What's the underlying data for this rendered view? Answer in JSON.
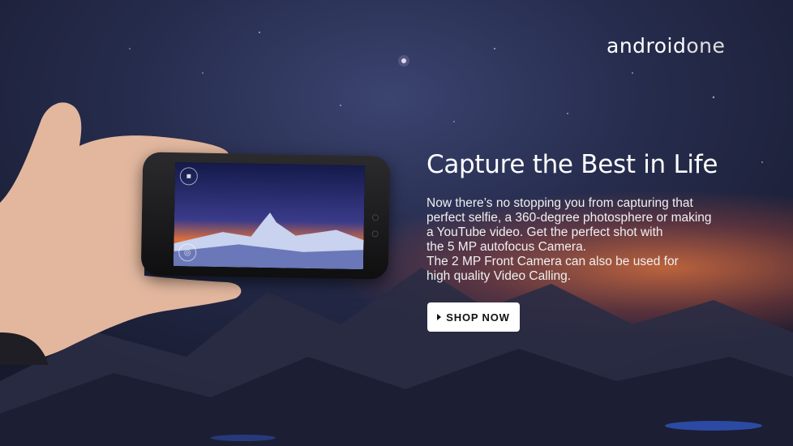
{
  "brand": {
    "part1": "android",
    "part2": "one"
  },
  "headline": "Capture the Best in Life",
  "body_lines": [
    "Now there’s no stopping you from capturing that",
    "perfect selfie, a 360-degree photosphere or making",
    "a YouTube video. Get the perfect shot with",
    "the 5 MP autofocus Camera.",
    "The 2 MP Front Camera can also be used for",
    "high quality Video Calling."
  ],
  "cta": {
    "label": "SHOP NOW",
    "icon": "play-icon"
  },
  "phone": {
    "top_icon": "video-camera-icon",
    "bottom_icon": "camera-switch-icon"
  },
  "colors": {
    "button_bg": "#ffffff",
    "text": "#ffffff",
    "sky_glow": "#e8783c"
  }
}
